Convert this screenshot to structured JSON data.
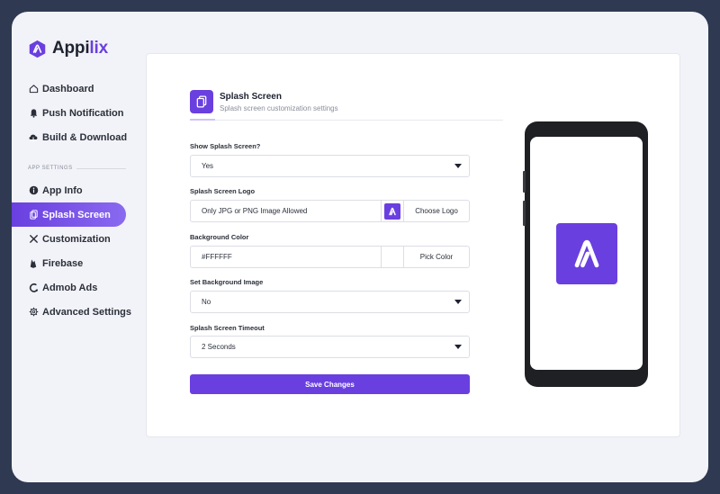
{
  "brand": {
    "name_part1": "Appi",
    "name_part2": "lix",
    "accent_color": "#6a3fe0"
  },
  "sidebar": {
    "items_top": [
      {
        "label": "Dashboard",
        "icon": "home-icon"
      },
      {
        "label": "Push Notification",
        "icon": "bell-icon"
      },
      {
        "label": "Build & Download",
        "icon": "cloud-download-icon"
      }
    ],
    "section_label": "APP SETTINGS",
    "items_settings": [
      {
        "label": "App Info",
        "icon": "info-icon"
      },
      {
        "label": "Splash Screen",
        "icon": "splash-icon",
        "active": true
      },
      {
        "label": "Customization",
        "icon": "tools-icon"
      },
      {
        "label": "Firebase",
        "icon": "firebase-icon"
      },
      {
        "label": "Admob Ads",
        "icon": "admob-icon"
      },
      {
        "label": "Advanced Settings",
        "icon": "gear-icon"
      }
    ]
  },
  "page": {
    "title": "Splash Screen",
    "subtitle": "Splash screen customization settings"
  },
  "form": {
    "show_splash": {
      "label": "Show Splash Screen?",
      "value": "Yes"
    },
    "logo": {
      "label": "Splash Screen Logo",
      "placeholder": "Only JPG or PNG Image Allowed",
      "button": "Choose Logo"
    },
    "bg_color": {
      "label": "Background Color",
      "value": "#FFFFFF",
      "button": "Pick Color"
    },
    "bg_image": {
      "label": "Set Background Image",
      "value": "No"
    },
    "timeout": {
      "label": "Splash Screen Timeout",
      "value": "2 Seconds"
    },
    "save_label": "Save Changes"
  },
  "preview": {
    "background": "#FFFFFF"
  }
}
